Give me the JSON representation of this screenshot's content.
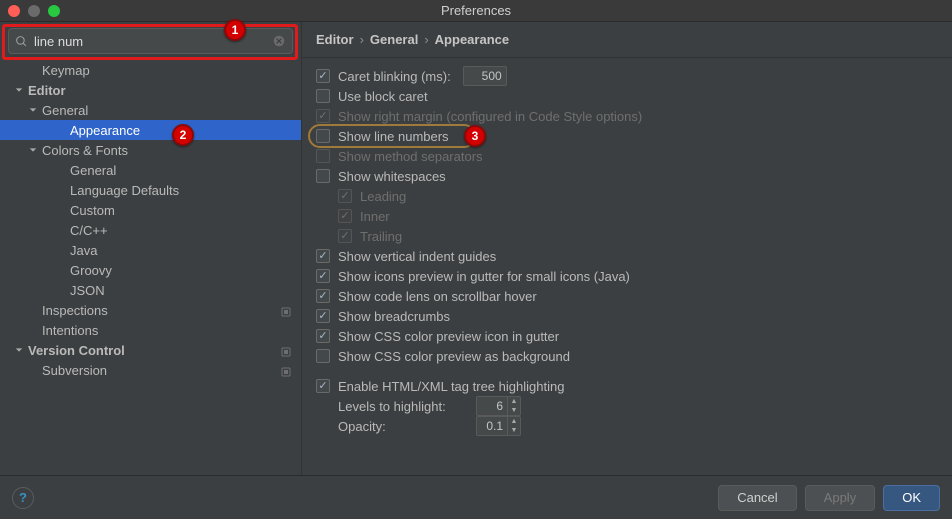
{
  "window": {
    "title": "Preferences"
  },
  "search": {
    "value": "line num"
  },
  "sidebar": {
    "items": [
      {
        "label": "Keymap",
        "indent": 28,
        "disclose": ""
      },
      {
        "label": "Editor",
        "indent": 14,
        "disclose": "down",
        "bold": true
      },
      {
        "label": "General",
        "indent": 28,
        "disclose": "down"
      },
      {
        "label": "Appearance",
        "indent": 56,
        "disclose": "",
        "selected": true
      },
      {
        "label": "Colors & Fonts",
        "indent": 28,
        "disclose": "down"
      },
      {
        "label": "General",
        "indent": 56,
        "disclose": ""
      },
      {
        "label": "Language Defaults",
        "indent": 56,
        "disclose": ""
      },
      {
        "label": "Custom",
        "indent": 56,
        "disclose": ""
      },
      {
        "label": "C/C++",
        "indent": 56,
        "disclose": ""
      },
      {
        "label": "Java",
        "indent": 56,
        "disclose": ""
      },
      {
        "label": "Groovy",
        "indent": 56,
        "disclose": ""
      },
      {
        "label": "JSON",
        "indent": 56,
        "disclose": ""
      },
      {
        "label": "Inspections",
        "indent": 28,
        "disclose": "",
        "marker": true
      },
      {
        "label": "Intentions",
        "indent": 28,
        "disclose": ""
      },
      {
        "label": "Version Control",
        "indent": 14,
        "disclose": "down",
        "bold": true,
        "marker": true
      },
      {
        "label": "Subversion",
        "indent": 28,
        "disclose": "",
        "marker": true
      }
    ]
  },
  "breadcrumb": {
    "parts": [
      "Editor",
      "General",
      "Appearance"
    ]
  },
  "options": {
    "caret_blinking_label": "Caret blinking (ms):",
    "caret_blinking_value": "500",
    "use_block_caret": "Use block caret",
    "show_right_margin": "Show right margin (configured in Code Style options)",
    "show_line_numbers": "Show line numbers",
    "show_method_separators": "Show method separators",
    "show_whitespaces": "Show whitespaces",
    "leading": "Leading",
    "inner": "Inner",
    "trailing": "Trailing",
    "vertical_indent": "Show vertical indent guides",
    "icons_preview": "Show icons preview in gutter for small icons (Java)",
    "code_lens": "Show code lens on scrollbar hover",
    "breadcrumbs": "Show breadcrumbs",
    "css_gutter": "Show CSS color preview icon in gutter",
    "css_bg": "Show CSS color preview as background",
    "html_highlight": "Enable HTML/XML tag tree highlighting",
    "levels_label": "Levels to highlight:",
    "levels_value": "6",
    "opacity_label": "Opacity:",
    "opacity_value": "0.1"
  },
  "footer": {
    "cancel": "Cancel",
    "apply": "Apply",
    "ok": "OK"
  },
  "annotations": {
    "badge1": "1",
    "badge2": "2",
    "badge3": "3"
  }
}
